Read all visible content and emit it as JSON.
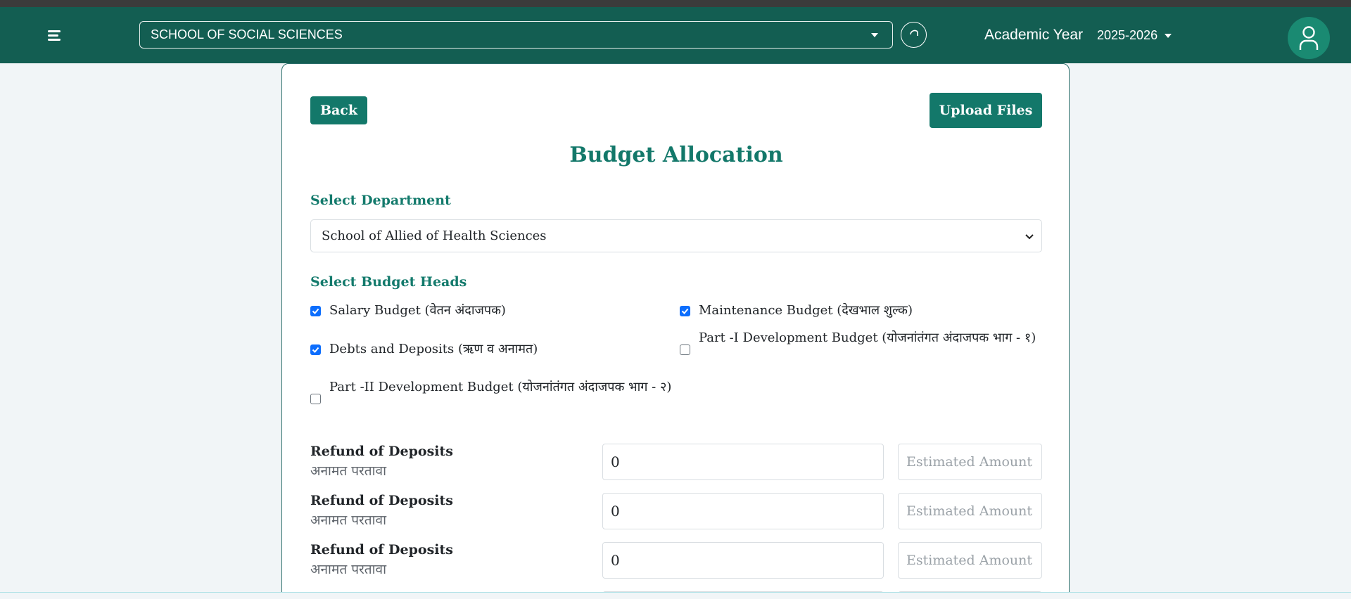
{
  "header": {
    "school": "SCHOOL OF SOCIAL SCIENCES",
    "academic_year_label": "Academic Year",
    "academic_year": "2025-2026"
  },
  "actions": {
    "back": "Back",
    "upload": "Upload Files"
  },
  "page_title": "Budget Allocation",
  "department": {
    "label": "Select Department",
    "selected": "School of Allied of Health Sciences"
  },
  "budget_heads": {
    "label": "Select Budget Heads",
    "items": [
      {
        "label": "Salary Budget (वेतन अंदाजपक)",
        "checked": true
      },
      {
        "label": "Maintenance Budget (देखभाल शुल्क)",
        "checked": true
      },
      {
        "label": "Debts and Deposits (ऋण व अनामत)",
        "checked": true
      },
      {
        "label": "Part -I Development Budget (योजनांतंगत अंदाजपक भाग - १)",
        "checked": false
      },
      {
        "label": "Part -II Development Budget (योजनांतंगत अंदाजपक भाग - २)",
        "checked": false
      }
    ]
  },
  "rows": [
    {
      "title": "Refund of Deposits",
      "subtitle": "अनामत परतावा",
      "amount": "0",
      "estimated_placeholder": "Estimated Amount"
    },
    {
      "title": "Refund of Deposits",
      "subtitle": "अनामत परतावा",
      "amount": "0",
      "estimated_placeholder": "Estimated Amount"
    },
    {
      "title": "Refund of Deposits",
      "subtitle": "अनामत परतावा",
      "amount": "0",
      "estimated_placeholder": "Estimated Amount"
    }
  ],
  "colors": {
    "navbar": "#135e52",
    "accent": "#13786a",
    "checkbox": "#0d6efd"
  }
}
